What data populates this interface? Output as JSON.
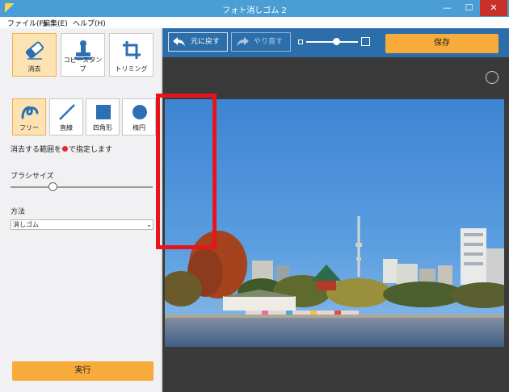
{
  "window": {
    "title": "フォト消しゴム 2",
    "minimize": "—",
    "maximize": "☐",
    "close": "✕"
  },
  "menu": [
    {
      "label": "ファイル(F)"
    },
    {
      "label": "編集(E)"
    },
    {
      "label": "ヘルプ(H)"
    }
  ],
  "tools": [
    {
      "label": "消去",
      "icon": "eraser-icon",
      "active": true
    },
    {
      "label": "コピースタンプ",
      "icon": "stamp-icon",
      "active": false
    },
    {
      "label": "トリミング",
      "icon": "crop-icon",
      "active": false
    }
  ],
  "shapes": [
    {
      "label": "フリー",
      "icon": "freehand-icon",
      "active": true
    },
    {
      "label": "直線",
      "icon": "line-icon",
      "active": false
    },
    {
      "label": "四角形",
      "icon": "rectangle-icon",
      "active": false
    },
    {
      "label": "楕円",
      "icon": "ellipse-icon",
      "active": false
    }
  ],
  "hint": {
    "before": "消去する範囲を",
    "after": "で指定します"
  },
  "brush": {
    "label": "ブラシサイズ",
    "value": 0.3
  },
  "method": {
    "label": "方法",
    "selected": "消しゴム"
  },
  "run_label": "実行",
  "toolbar": {
    "undo_label": "元に戻す",
    "redo_label": "やり直す",
    "zoom_level": 0.6,
    "save_label": "保存"
  },
  "colors": {
    "titlebar": "#4a9ed4",
    "accent": "#f7ab3a",
    "toolbar": "#2c6eaa",
    "active_tool": "#fde3b4",
    "icon_blue": "#2e6fb3",
    "selection": "#e8141b"
  }
}
